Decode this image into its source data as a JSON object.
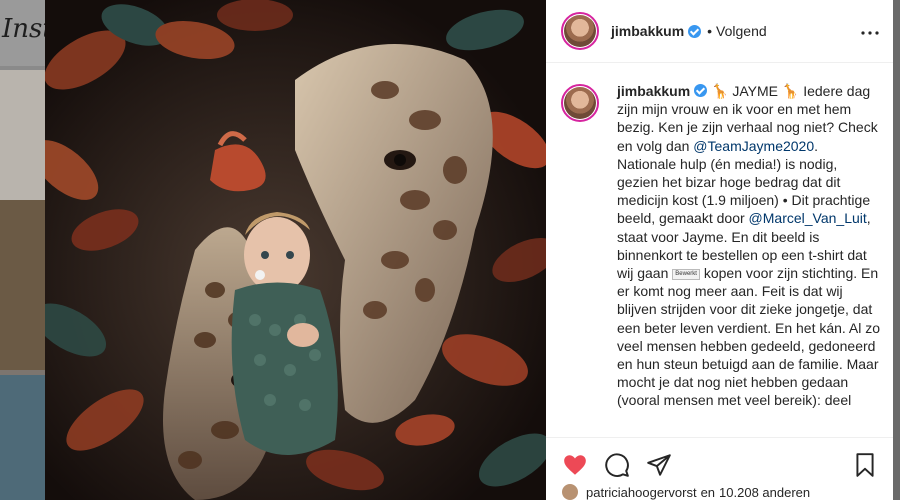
{
  "background": {
    "logo_text": "Insta"
  },
  "post": {
    "next_icon": "chevron-right-icon"
  },
  "header": {
    "username": "jimbakkum",
    "separator": "•",
    "follow_status": "Volgend",
    "more_icon": "ellipsis-icon"
  },
  "caption": {
    "username": "jimbakkum",
    "emoji_left": "🦒",
    "title": "JAYME",
    "emoji_right": "🦒",
    "p1": "Iedere dag zijn mijn vrouw en ik voor en met hem bezig. Ken je zijn verhaal nog niet? Check en volg dan",
    "mention1": "@TeamJayme2020",
    "p2": ". Nationale hulp (én media!) is nodig, gezien het bizar hoge bedrag dat dit medicijn kost (1.9 miljoen) • Dit prachtige beeld, gemaakt door",
    "mention2": "@Marcel_Van_Luit",
    "p3": ", staat voor Jayme. En dit beeld is binnenkort te bestellen op een t-shirt dat wij gaan",
    "tooltip": "Bewerkt",
    "p4": "kopen voor zijn stichting. En er komt nog meer aan. Feit is dat wij blijven strijden voor dit zieke jongetje, dat een beter leven verdient. En het kán. Al zo veel mensen hebben gedeeld, gedoneerd en hun steun betuigd aan de familie. Maar mocht je dat nog niet hebben gedaan (vooral mensen met veel bereik): deel"
  },
  "actions": {
    "like_icon": "heart-filled-icon",
    "comment_icon": "comment-icon",
    "share_icon": "paper-plane-icon",
    "save_icon": "bookmark-icon",
    "like_color": "#ed4956"
  },
  "likes": {
    "liked_by": "patriciahoogervorst",
    "connector": "en",
    "others": "10.208 anderen"
  }
}
